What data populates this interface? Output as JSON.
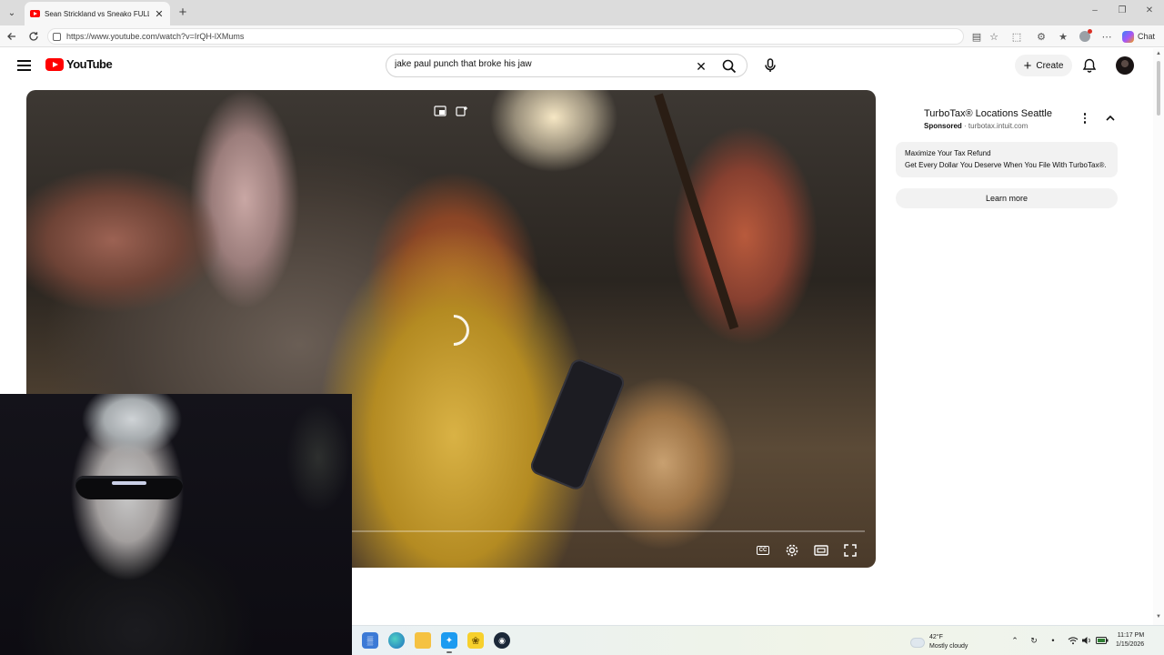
{
  "browser": {
    "tab_title": "Sean Strickland vs Sneako FULL FIGHT",
    "url": "https://www.youtube.com/watch?v=IrQH-lXMums",
    "copilot_label": "Chat",
    "load_progress": 0.79
  },
  "youtube": {
    "logo_text": "YouTube",
    "search_query": "jake paul punch that broke his jaw",
    "create_label": "Create"
  },
  "ad": {
    "title": "TurboTax® Locations Seattle",
    "sponsored": "Sponsored",
    "domain": "turbotax.intuit.com",
    "headline": "Maximize Your Tax Refund",
    "description": "Get Every Dollar You Deserve When You File With TurboTax®. Start Today.",
    "cta": "Learn more"
  },
  "player": {
    "state": "loading",
    "icons": [
      "miniplayer-icon",
      "add-to-queue-icon",
      "captions-icon",
      "settings-icon",
      "theater-mode-icon",
      "fullscreen-icon"
    ]
  },
  "taskbar": {
    "apps": [
      "calculator",
      "edge",
      "file-explorer",
      "twitter",
      "photos",
      "steam"
    ],
    "weather_temp": "42°F",
    "weather_desc": "Mostly cloudy",
    "time": "11:17 PM",
    "date": "1/15/2026"
  },
  "colors": {
    "youtube_red": "#ff0000",
    "load_bar": "#ff0033",
    "chip_bg": "#f2f2f2"
  }
}
